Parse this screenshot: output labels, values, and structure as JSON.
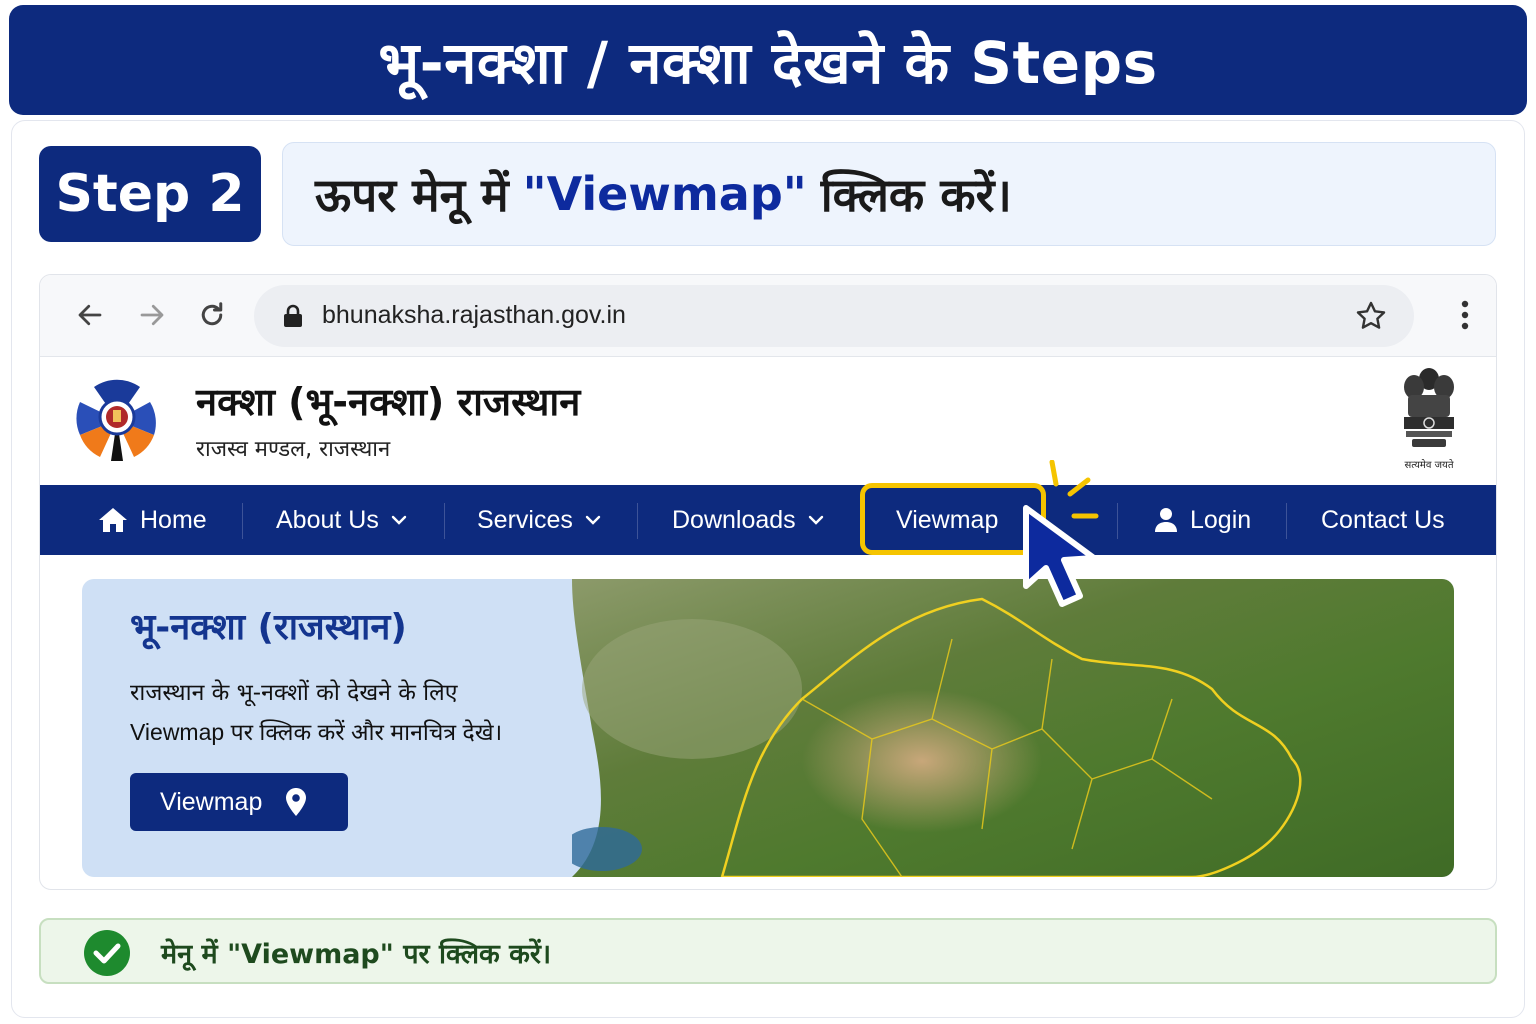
{
  "banner": {
    "title": "भू-नक्शा / नक्शा देखने के Steps"
  },
  "step": {
    "badge": "Step 2",
    "instruction_before": "ऊपर मेनू में",
    "instruction_highlight": "\"Viewmap\"",
    "instruction_after": "क्लिक करें।"
  },
  "browser": {
    "url": "bhunaksha.rajasthan.gov.in",
    "icons": [
      "back-arrow-icon",
      "forward-arrow-icon",
      "reload-icon",
      "lock-icon",
      "bookmark-star-icon",
      "more-vert-icon"
    ]
  },
  "site": {
    "title": "नक्शा (भू-नक्शा) राजस्थान",
    "subtitle": "राजस्व मण्डल, राजस्थान",
    "emblem_caption": "सत्यमेव जयते"
  },
  "menu": {
    "home": "Home",
    "about": "About Us",
    "services": "Services",
    "downloads": "Downloads",
    "viewmap": "Viewmap",
    "login": "Login",
    "contact": "Contact Us",
    "highlighted_item": "Viewmap"
  },
  "hero": {
    "title": "भू-नक्शा (राजस्थान)",
    "line1": "राजस्थान के भू-नक्शों को देखने के लिए",
    "line2": "Viewmap पर क्लिक करें और मानचित्र देखे।",
    "button": "Viewmap"
  },
  "success": {
    "message": "मेनू में \"Viewmap\" पर क्लिक करें।"
  },
  "colors": {
    "brand_navy": "#0d2a7e",
    "highlight_yellow": "#f5c400",
    "success_green": "#1e8a2e"
  }
}
